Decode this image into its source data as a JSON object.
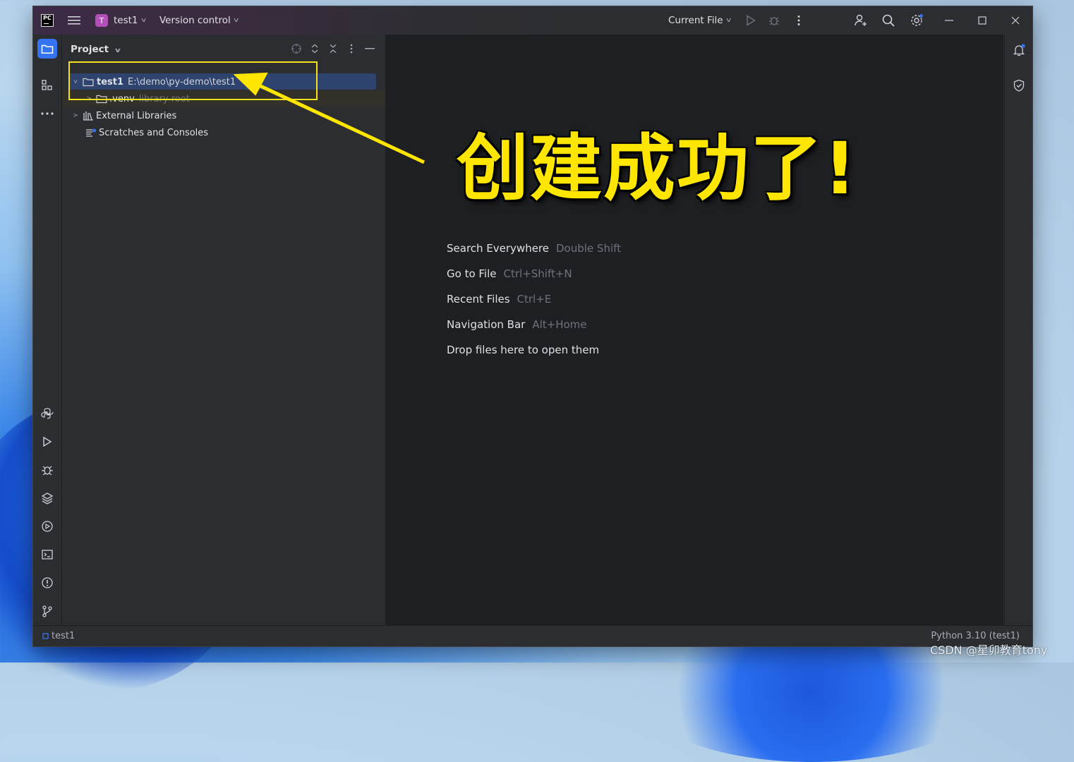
{
  "titlebar": {
    "project_badge": "T",
    "project_name": "test1",
    "vcs_label": "Version control",
    "run_config": "Current File"
  },
  "project_panel": {
    "title": "Project",
    "tree": [
      {
        "name": "test1",
        "detail": "E:\\demo\\py-demo\\test1"
      },
      {
        "name": ".venv",
        "detail": "library root"
      },
      {
        "name": "External Libraries"
      },
      {
        "name": "Scratches and Consoles"
      }
    ]
  },
  "editor": {
    "annotation": "创建成功了!",
    "hints": [
      {
        "label": "Search Everywhere",
        "key": "Double Shift"
      },
      {
        "label": "Go to File",
        "key": "Ctrl+Shift+N"
      },
      {
        "label": "Recent Files",
        "key": "Ctrl+E"
      },
      {
        "label": "Navigation Bar",
        "key": "Alt+Home"
      },
      {
        "label": "Drop files here to open them",
        "key": ""
      }
    ]
  },
  "statusbar": {
    "breadcrumb": "test1",
    "interpreter": "Python 3.10 (test1)"
  },
  "watermark": "CSDN @星卯教育tony",
  "colors": {
    "accent": "#3574f0",
    "annotation": "#ffe600",
    "highlight_box": "#f5e11c"
  }
}
